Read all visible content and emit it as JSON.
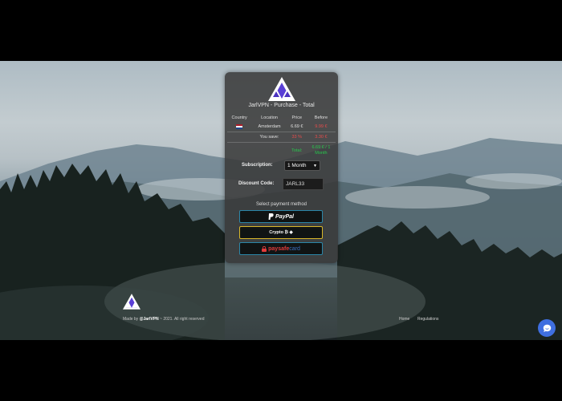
{
  "card": {
    "title": "JarlVPN - Purchase - Total",
    "columns": [
      "Country",
      "Location",
      "Price",
      "Before"
    ],
    "row": {
      "location": "Amsterdam",
      "price": "6.69 €",
      "before": "9.99 €"
    },
    "save": {
      "label": "You save:",
      "percent": "33 %",
      "amount": "3.30 €"
    },
    "total": {
      "label": "Total:",
      "line1": "6.69 € / 1",
      "line2": "Month"
    },
    "subscription": {
      "label": "Subscription:",
      "value": "1 Month"
    },
    "discount": {
      "label": "Discount Code:",
      "value": "JARL33"
    },
    "payment": {
      "title": "Select payment method",
      "paypal": "PayPal",
      "crypto": "Crypto ₿ ◆",
      "paysafe_main": "paysafe",
      "paysafe_suffix": "card"
    }
  },
  "footer": {
    "made_by_prefix": "Made by ",
    "brand": "@JarlVPN",
    "made_by_suffix": " ~ 2021. All right reserved",
    "nav": [
      "Home",
      "Regulations"
    ]
  },
  "icons": {
    "logo": "jarlvpn-logo-icon",
    "flag": "netherlands-flag-icon",
    "chevron": "chevron-down-icon",
    "chat": "chat-bubble-icon"
  },
  "colors": {
    "accent_purple": "#5a3fd6",
    "price_red": "#e74c4c",
    "total_green": "#27c94c",
    "paypal_border": "#2b86a8",
    "crypto_border": "#d8b72a",
    "chat_blue": "#3f6fe0"
  }
}
